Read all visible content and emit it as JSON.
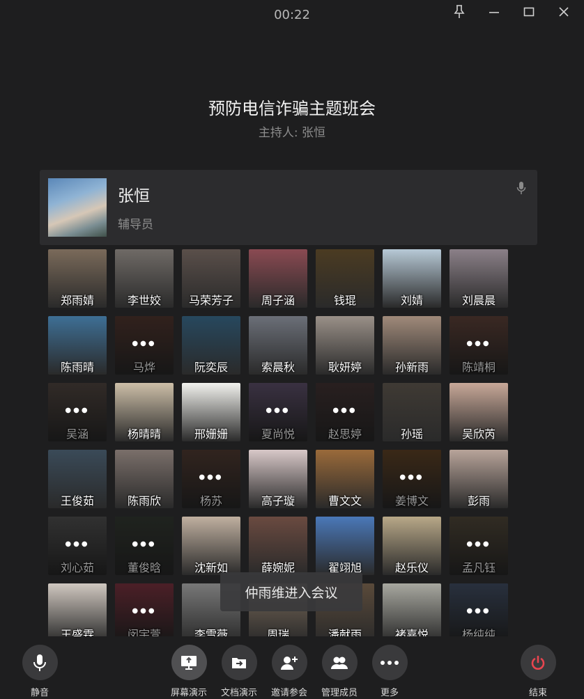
{
  "meeting": {
    "timer": "00:22",
    "title": "预防电信诈骗主题班会",
    "host_line": "主持人: 张恒"
  },
  "host_card": {
    "name": "张恒",
    "role": "辅导员",
    "icon": "mic-icon"
  },
  "participants": [
    {
      "name": "郑雨婧",
      "video": true,
      "bg": "#7a6a5a"
    },
    {
      "name": "李世姣",
      "video": true,
      "bg": "#6f6a66"
    },
    {
      "name": "马荣芳子",
      "video": true,
      "bg": "#5a4f4a"
    },
    {
      "name": "周子涵",
      "video": true,
      "bg": "#8a4a52"
    },
    {
      "name": "钱琨",
      "video": true,
      "bg": "#4b3b22"
    },
    {
      "name": "刘婧",
      "video": true,
      "bg": "#b7c9d6"
    },
    {
      "name": "刘晨晨",
      "video": true,
      "bg": "#8b8088"
    },
    {
      "name": "陈雨晴",
      "video": true,
      "bg": "#3e6f95"
    },
    {
      "name": "马烨",
      "video": false,
      "bg": "#5a3d35"
    },
    {
      "name": "阮奕辰",
      "video": true,
      "bg": "#27485e"
    },
    {
      "name": "索晨秋",
      "video": true,
      "bg": "#6b6f78"
    },
    {
      "name": "耿妍婷",
      "video": true,
      "bg": "#9a9088"
    },
    {
      "name": "孙新雨",
      "video": true,
      "bg": "#a08a7a"
    },
    {
      "name": "陈靖桐",
      "video": false,
      "bg": "#6a4a40"
    },
    {
      "name": "吴涵",
      "video": false,
      "bg": "#5a4e48"
    },
    {
      "name": "杨晴晴",
      "video": true,
      "bg": "#cdbfa8"
    },
    {
      "name": "邢姗姗",
      "video": true,
      "bg": "#f2f2ee"
    },
    {
      "name": "夏尚悦",
      "video": false,
      "bg": "#6a5a78"
    },
    {
      "name": "赵思婷",
      "video": false,
      "bg": "#4a3a3a"
    },
    {
      "name": "孙瑶",
      "video": true,
      "bg": "#3f3a34"
    },
    {
      "name": "吴欣芮",
      "video": true,
      "bg": "#c8a898"
    },
    {
      "name": "王俊茹",
      "video": true,
      "bg": "#3a4a58"
    },
    {
      "name": "陈雨欣",
      "video": true,
      "bg": "#7a6f6a"
    },
    {
      "name": "杨苏",
      "video": false,
      "bg": "#5a4238"
    },
    {
      "name": "高子璇",
      "video": true,
      "bg": "#d8c8c8"
    },
    {
      "name": "曹文文",
      "video": true,
      "bg": "#9a6a3a"
    },
    {
      "name": "姜博文",
      "video": false,
      "bg": "#6a4a2a"
    },
    {
      "name": "彭雨",
      "video": true,
      "bg": "#b8a49a"
    },
    {
      "name": "刘心茹",
      "video": false,
      "bg": "#5a5a5a"
    },
    {
      "name": "董俊晗",
      "video": false,
      "bg": "#3a4038"
    },
    {
      "name": "沈新如",
      "video": true,
      "bg": "#c0b0a0"
    },
    {
      "name": "薛婉妮",
      "video": true,
      "bg": "#6a4a40"
    },
    {
      "name": "翟翊旭",
      "video": true,
      "bg": "#4a78b8"
    },
    {
      "name": "赵乐仪",
      "video": true,
      "bg": "#b8a888"
    },
    {
      "name": "孟凡钰",
      "video": false,
      "bg": "#5a5040"
    },
    {
      "name": "王盛霖",
      "video": true,
      "bg": "#d0c8c0"
    },
    {
      "name": "闵宇萱",
      "video": false,
      "bg": "#8a3a48"
    },
    {
      "name": "李雪薇",
      "video": true,
      "bg": "#787878"
    },
    {
      "name": "周瑞",
      "video": true,
      "bg": "#7a6a5a"
    },
    {
      "name": "潘献雨",
      "video": true,
      "bg": "#5a4a3a"
    },
    {
      "name": "褚嘉悦",
      "video": true,
      "bg": "#a8a8a0"
    },
    {
      "name": "杨纯纯",
      "video": false,
      "bg": "#4a5870"
    }
  ],
  "toast": "仲雨维进入会议",
  "toolbar": [
    {
      "key": "mute",
      "label": "静音",
      "icon": "microphone-icon"
    },
    {
      "key": "screen",
      "label": "屏幕演示",
      "icon": "screen-share-icon"
    },
    {
      "key": "doc",
      "label": "文档演示",
      "icon": "folder-share-icon"
    },
    {
      "key": "invite",
      "label": "邀请参会",
      "icon": "invite-user-icon"
    },
    {
      "key": "members",
      "label": "管理成员",
      "icon": "members-icon"
    },
    {
      "key": "more",
      "label": "更多",
      "icon": "more-icon"
    },
    {
      "key": "end",
      "label": "结束",
      "icon": "power-icon"
    }
  ],
  "colors": {
    "background": "#1e1e1f",
    "panel": "#2c2c2e",
    "button": "#3a3a3c",
    "end_red": "#e8454f"
  }
}
